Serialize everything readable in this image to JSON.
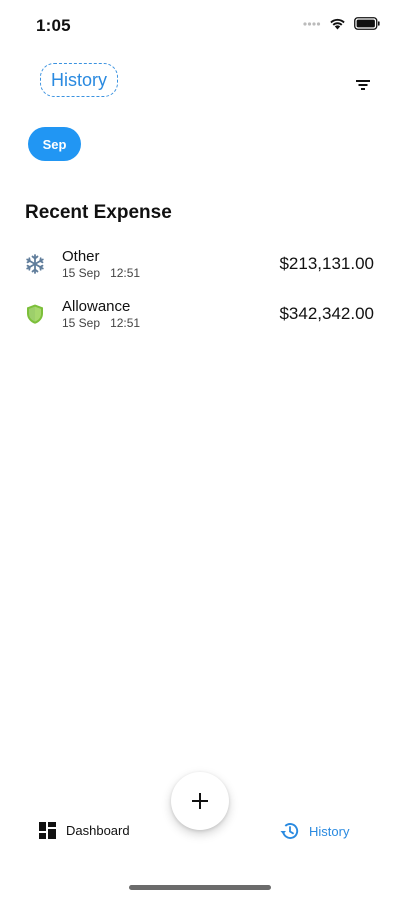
{
  "status_bar": {
    "time": "1:05",
    "icons": [
      "signal-dots-icon",
      "wifi-icon",
      "battery-icon"
    ]
  },
  "header": {
    "title": "History",
    "filter_icon": "filter-icon"
  },
  "month_chip": {
    "label": "Sep"
  },
  "section": {
    "title": "Recent Expense"
  },
  "expenses": [
    {
      "name": "Other",
      "date": "15 Sep",
      "time": "12:51",
      "amount": "$213,131.00",
      "icon": "snowflake-icon",
      "icon_color": "#607d9b"
    },
    {
      "name": "Allowance",
      "date": "15 Sep",
      "time": "12:51",
      "amount": "$342,342.00",
      "icon": "shield-icon",
      "icon_color": "#7cbf3a"
    }
  ],
  "bottom_nav": {
    "dashboard_label": "Dashboard",
    "history_label": "History",
    "active_color": "#2a8ae0"
  },
  "fab": {
    "icon": "plus-icon"
  },
  "colors": {
    "accent": "#2196f3",
    "text": "#111111"
  }
}
